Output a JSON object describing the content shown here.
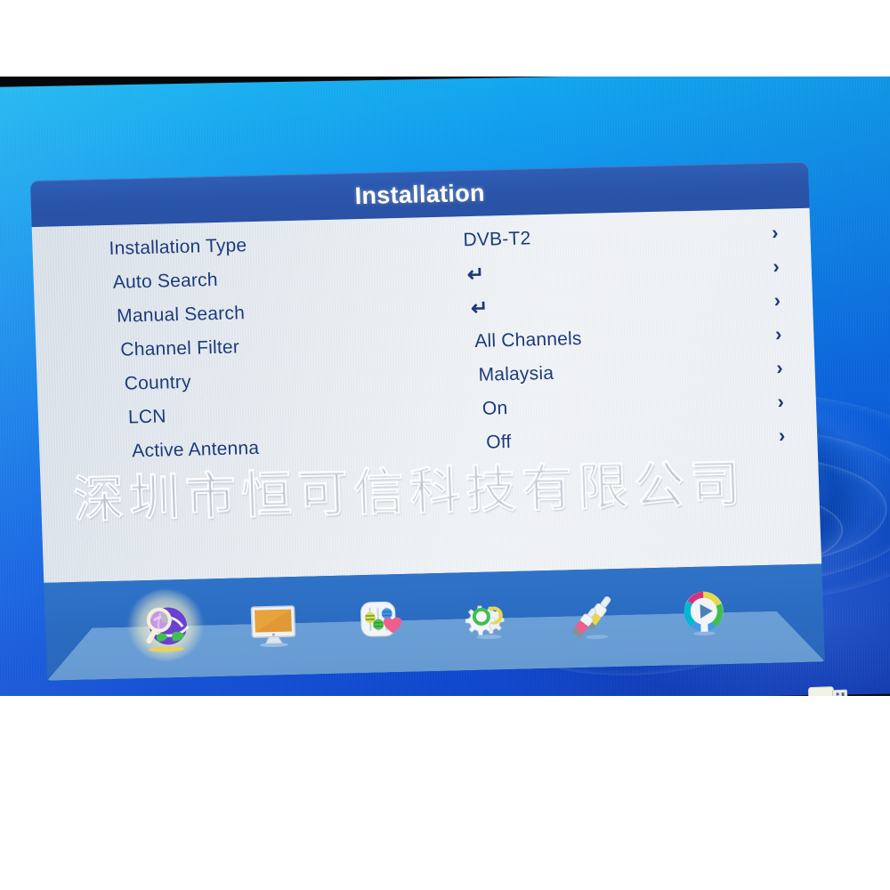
{
  "screen": {
    "device_kind": "dvb-set-top-box-osd",
    "background_colors": {
      "screen_top": "#12b2f0",
      "screen_bottom": "#1240c4",
      "panel_title_bar": "#2a55ab",
      "panel_body": "#e6ebf0",
      "dock_bar": "#2a6bc0",
      "dock_shelf": "#6ea1d6",
      "text_blue": "#1b3a7a"
    }
  },
  "panel": {
    "title": "Installation",
    "rows": [
      {
        "label": "Installation Type",
        "value": "DVB-T2",
        "value_kind": "text",
        "arrow": "›"
      },
      {
        "label": "Auto Search",
        "value": "↵",
        "value_kind": "enter",
        "arrow": "›"
      },
      {
        "label": "Manual Search",
        "value": "↵",
        "value_kind": "enter",
        "arrow": "›"
      },
      {
        "label": "Channel Filter",
        "value": "All Channels",
        "value_kind": "text",
        "arrow": "›"
      },
      {
        "label": "Country",
        "value": "Malaysia",
        "value_kind": "text",
        "arrow": "›"
      },
      {
        "label": "LCN",
        "value": "On",
        "value_kind": "text",
        "arrow": "›"
      },
      {
        "label": "Active Antenna",
        "value": "Off",
        "value_kind": "text",
        "arrow": "›"
      }
    ]
  },
  "watermark": {
    "text": "深圳市恒可信科技有限公司"
  },
  "dock": {
    "items": [
      {
        "name": "installation",
        "icon": "globe-magnifier-icon",
        "selected": true
      },
      {
        "name": "picture",
        "icon": "monitor-icon",
        "selected": false
      },
      {
        "name": "channel",
        "icon": "channel-heart-icon",
        "selected": false
      },
      {
        "name": "system",
        "icon": "gears-icon",
        "selected": false
      },
      {
        "name": "interface",
        "icon": "rca-cables-icon",
        "selected": false
      },
      {
        "name": "media",
        "icon": "media-play-icon",
        "selected": false
      }
    ],
    "offscreen_item": {
      "name": "usb",
      "icon": "usb-drive-icon"
    }
  }
}
